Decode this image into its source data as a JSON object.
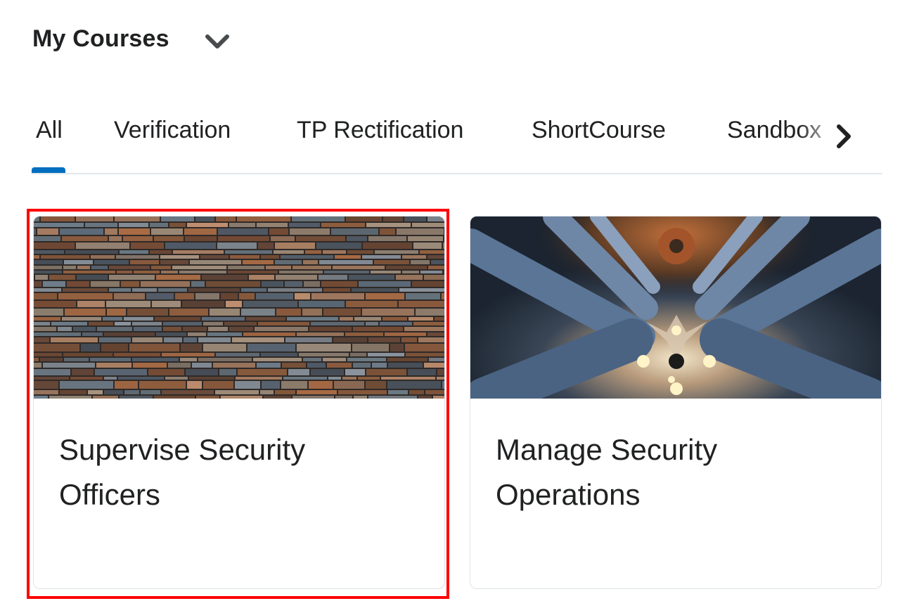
{
  "header": {
    "title": "My Courses",
    "menu_icon": "chevron-down-icon"
  },
  "tabs": [
    {
      "label": "All",
      "active": true
    },
    {
      "label": "Verification",
      "active": false
    },
    {
      "label": "TP Rectification",
      "active": false
    },
    {
      "label": "ShortCourse",
      "active": false
    },
    {
      "label": "Sandbox",
      "active": false
    }
  ],
  "tabs_next_icon": "chevron-right-icon",
  "accent_color": "#006fbf",
  "highlight_color": "#ff0000",
  "courses": [
    {
      "title": "Supervise Security Officers",
      "image": "stone-wall-image",
      "highlighted": true
    },
    {
      "title": "Manage Security Operations",
      "image": "cathedral-ceiling-image",
      "highlighted": false
    }
  ]
}
